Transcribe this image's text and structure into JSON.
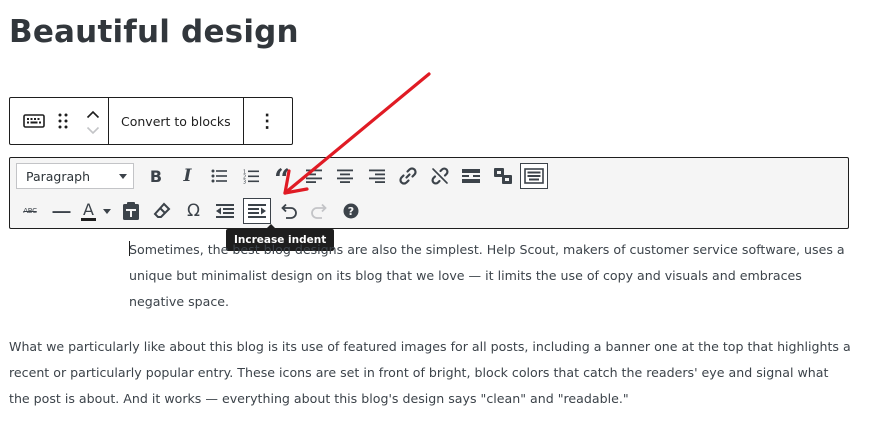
{
  "title": "Beautiful design",
  "block_toolbar": {
    "keyboard_icon": "keyboard-icon",
    "drag_icon": "drag-handle-icon",
    "move_up_icon": "chevron-up-icon",
    "move_down_icon": "chevron-down-icon",
    "convert_label": "Convert to blocks",
    "more_icon": "more-vertical-icon",
    "more_label": "⋮"
  },
  "classic_toolbar": {
    "format_select": {
      "selected": "Paragraph"
    },
    "row1": [
      {
        "name": "bold",
        "glyph": "B"
      },
      {
        "name": "italic",
        "glyph": "I"
      },
      {
        "name": "bullet-list",
        "icon": "bullet-list-icon"
      },
      {
        "name": "numbered-list",
        "icon": "numbered-list-icon"
      },
      {
        "name": "blockquote",
        "glyph": "“"
      },
      {
        "name": "align-left",
        "icon": "align-left-icon"
      },
      {
        "name": "align-center",
        "icon": "align-center-icon"
      },
      {
        "name": "align-right",
        "icon": "align-right-icon"
      },
      {
        "name": "insert-link",
        "icon": "link-icon"
      },
      {
        "name": "remove-link",
        "icon": "unlink-icon"
      },
      {
        "name": "read-more",
        "icon": "read-more-icon"
      },
      {
        "name": "page-break",
        "icon": "page-break-icon"
      },
      {
        "name": "toolbar-toggle",
        "icon": "keyboard-icon",
        "active": true
      }
    ],
    "row2": [
      {
        "name": "strikethrough",
        "glyph": "ABC"
      },
      {
        "name": "horizontal-line",
        "glyph": "—"
      },
      {
        "name": "text-color",
        "glyph": "A"
      },
      {
        "name": "paste-as-text",
        "icon": "clipboard-icon"
      },
      {
        "name": "clear-formatting",
        "icon": "eraser-icon"
      },
      {
        "name": "special-character",
        "glyph": "Ω"
      },
      {
        "name": "decrease-indent",
        "icon": "outdent-icon"
      },
      {
        "name": "increase-indent",
        "icon": "indent-icon",
        "active": true
      },
      {
        "name": "undo",
        "icon": "undo-icon"
      },
      {
        "name": "redo",
        "icon": "redo-icon"
      },
      {
        "name": "help",
        "icon": "help-icon"
      }
    ],
    "colors": {
      "icon": "#3c434a",
      "border": "#1e1e1e",
      "background": "#f5f5f5",
      "text_color_underline": "#1e1e1e"
    }
  },
  "tooltip": "Increase indent",
  "annotation": {
    "arrow_color": "#e01b24"
  },
  "content": {
    "paragraph1": "Sometimes, the best blog designs are also the simplest. Help Scout, makers of customer service software, uses a unique but minimalist design on its blog that we love — it limits the use of copy and visuals and embraces negative space.",
    "paragraph2": "What we particularly like about this blog is its use of featured images for all posts, including a banner one at the top that highlights a recent or particularly popular entry. These icons are set in front of bright, block colors that catch the readers' eye and signal what the post is about. And it works — everything about this blog's design says \"clean\" and \"readable.\""
  }
}
